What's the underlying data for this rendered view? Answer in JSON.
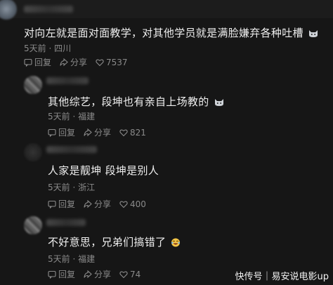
{
  "comments": [
    {
      "text": "对向左就是面对面教学，对其他学员就是满脸嫌弃各种吐槽",
      "time": "5天前",
      "location": "四川",
      "reply_label": "回复",
      "share_label": "分享",
      "likes": "7537",
      "emoji": "cat-face"
    },
    {
      "text": "其他综艺，段坤也有亲自上场教的",
      "time": "5天前",
      "location": "福建",
      "reply_label": "回复",
      "share_label": "分享",
      "likes": "821",
      "emoji": "cat-face"
    },
    {
      "text": "人家是靓坤 段坤是别人",
      "time": "5天前",
      "location": "浙江",
      "reply_label": "回复",
      "share_label": "分享",
      "likes": "400"
    },
    {
      "text": "不好意思，兄弟们搞错了",
      "time": "5天前",
      "location": "福建",
      "reply_label": "回复",
      "share_label": "分享",
      "likes": "74",
      "emoji": "laughing-face"
    }
  ],
  "separator": "·",
  "watermark": "快传号｜易安说电影up",
  "colors": {
    "background": "#161616",
    "text": "#efefef",
    "meta": "#8a8a8a"
  }
}
